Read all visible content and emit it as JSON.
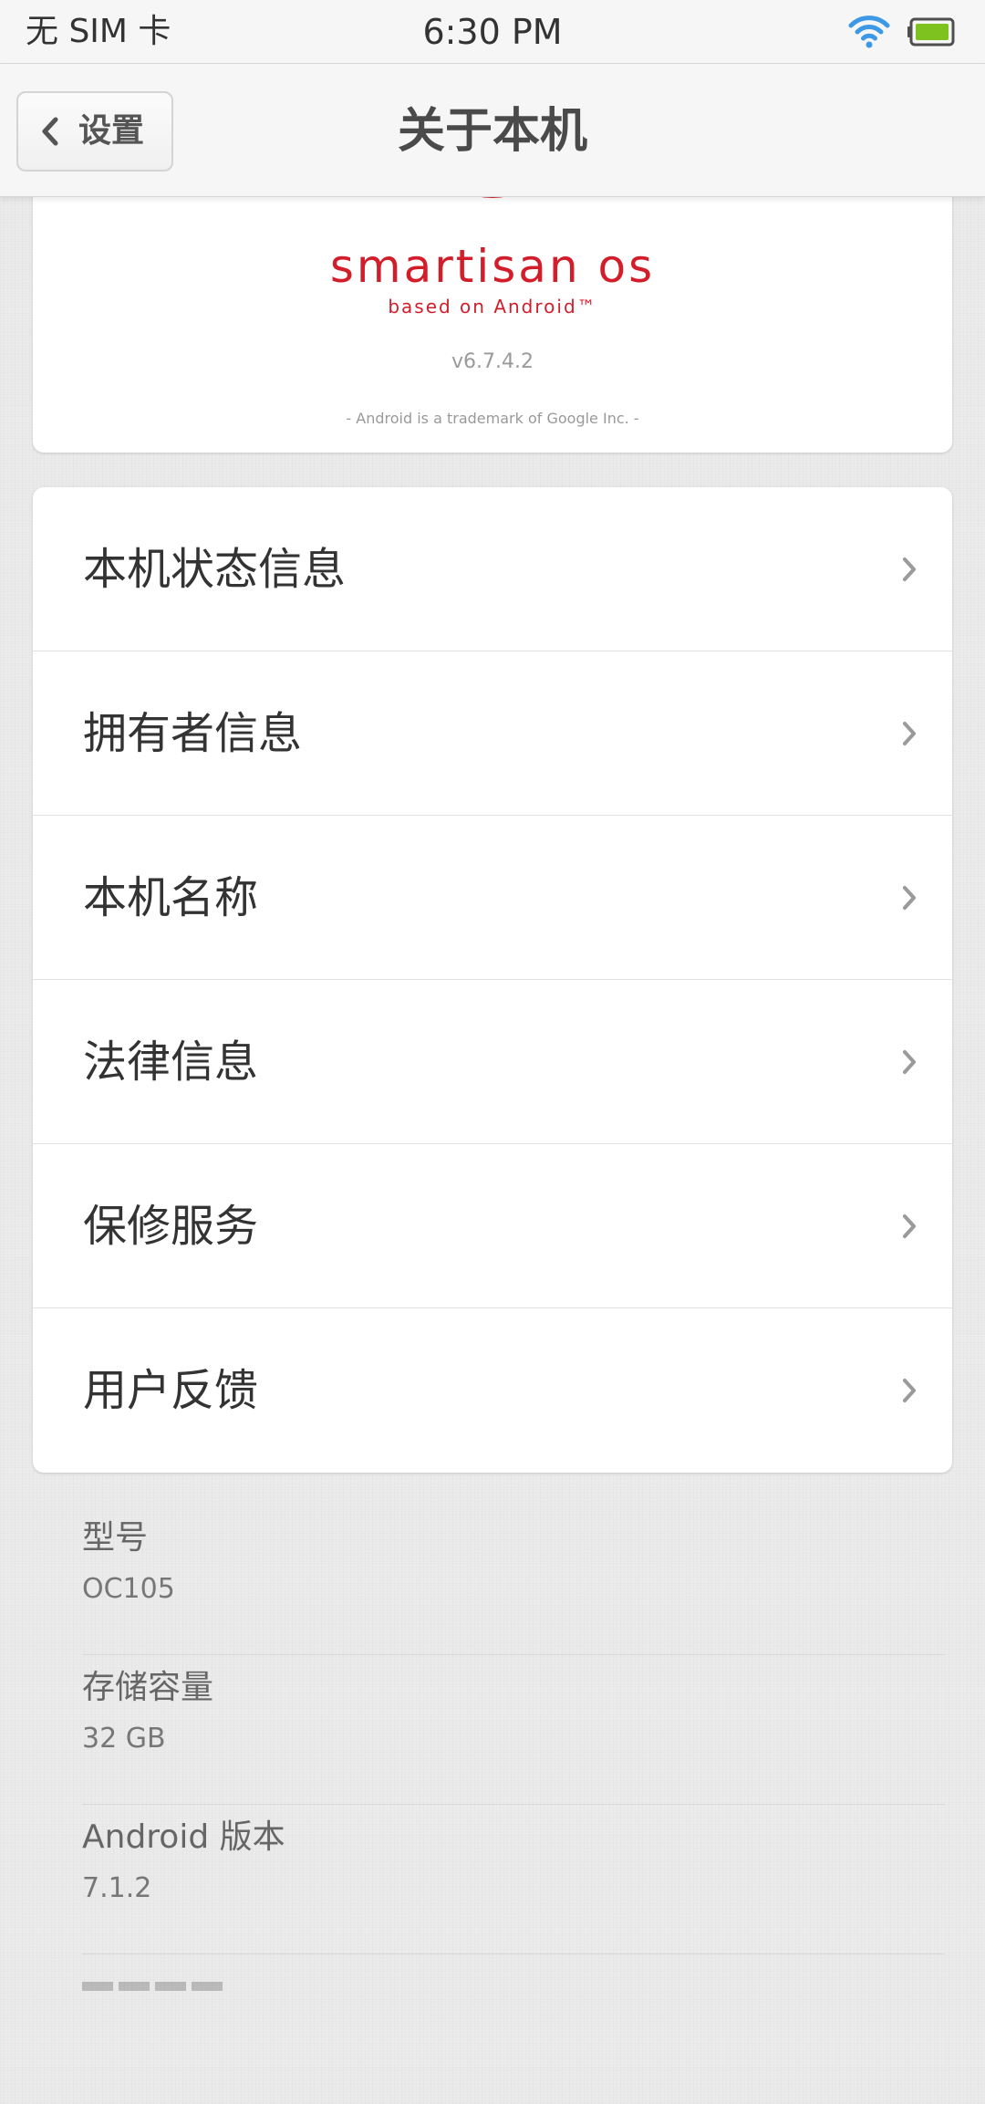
{
  "status_bar": {
    "carrier": "无 SIM 卡",
    "time": "6:30 PM",
    "wifi_icon": "wifi-icon",
    "battery_icon": "battery-icon",
    "wifi_color": "#3d98e6",
    "battery_color": "#7ec21f"
  },
  "nav": {
    "back_label": "设置",
    "title": "关于本机"
  },
  "about": {
    "brand": "smartisan os",
    "tagline": "based on Android™",
    "version": "v6.7.4.2",
    "trademark": "-  Android is a trademark of Google Inc.  -",
    "brand_color": "#d21e2b"
  },
  "menu": {
    "items": [
      {
        "label": "本机状态信息"
      },
      {
        "label": "拥有者信息"
      },
      {
        "label": "本机名称"
      },
      {
        "label": "法律信息"
      },
      {
        "label": "保修服务"
      },
      {
        "label": "用户反馈"
      }
    ]
  },
  "info": {
    "items": [
      {
        "label": "型号",
        "value": "OC105"
      },
      {
        "label": "存储容量",
        "value": "32 GB"
      },
      {
        "label": "Android 版本",
        "value": "7.1.2"
      }
    ]
  }
}
